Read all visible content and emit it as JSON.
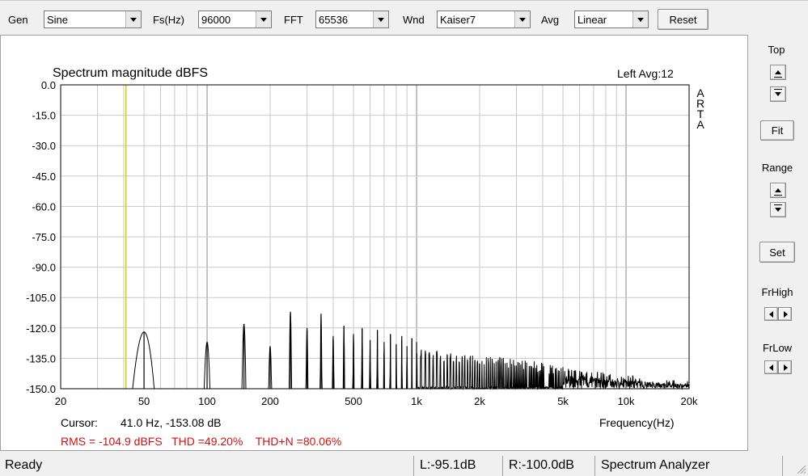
{
  "toolbar": {
    "gen_label": "Gen",
    "gen_value": "Sine",
    "fs_label": "Fs(Hz)",
    "fs_value": "96000",
    "fft_label": "FFT",
    "fft_value": "65536",
    "wnd_label": "Wnd",
    "wnd_value": "Kaiser7",
    "avg_label": "Avg",
    "avg_value": "Linear",
    "reset_label": "Reset"
  },
  "right_panel": {
    "top_label": "Top",
    "fit_label": "Fit",
    "range_label": "Range",
    "set_label": "Set",
    "frhigh_label": "FrHigh",
    "frlow_label": "FrLow"
  },
  "plot": {
    "vertical_watermark": "ARTA",
    "cursor_label": "Cursor:",
    "cursor_value": "41.0 Hz, -153.08 dB",
    "measurements": "RMS = -104.9 dBFS   THD =49.20%    THD+N =80.06%"
  },
  "chart_data": {
    "type": "line",
    "title": "Spectrum magnitude dBFS",
    "channel_info": "Left  Avg:12",
    "xlabel": "Frequency(Hz)",
    "ylabel": "",
    "x_scale": "log",
    "xlim": [
      20,
      20000
    ],
    "ylim": [
      -150,
      0
    ],
    "x_ticks": [
      20,
      50,
      100,
      200,
      500,
      1000,
      2000,
      5000,
      10000,
      20000
    ],
    "x_tick_labels": [
      "20",
      "50",
      "100",
      "200",
      "500",
      "1k",
      "2k",
      "5k",
      "10k",
      "20k"
    ],
    "y_ticks": [
      0,
      -15,
      -30,
      -45,
      -60,
      -75,
      -90,
      -105,
      -120,
      -135,
      -150
    ],
    "y_tick_labels": [
      "0.0",
      "-15.0",
      "-30.0",
      "-45.0",
      "-60.0",
      "-75.0",
      "-90.0",
      "-105.0",
      "-120.0",
      "-135.0",
      "-150.0"
    ],
    "grid": true,
    "cursor_frequency_hz": 41.0,
    "cursor_color": "#d4d400",
    "line_color": "#000000",
    "harmonic_peaks": {
      "frequencies_hz": [
        50,
        100,
        150,
        200,
        250,
        300,
        350,
        400,
        450,
        500,
        550,
        600,
        650,
        700,
        750,
        800,
        850,
        900,
        950,
        1000
      ],
      "levels_db": [
        -122,
        -127,
        -118,
        -129,
        -112,
        -120,
        -113,
        -124,
        -119,
        -123,
        -120,
        -126,
        -121,
        -127,
        -123,
        -128,
        -124,
        -129,
        -125,
        -127
      ]
    },
    "noise_floor": {
      "frequencies_hz": [
        1000,
        2000,
        3000,
        5000,
        10000,
        15000,
        20000
      ],
      "levels_db": [
        -130,
        -134,
        -135,
        -139,
        -143,
        -145,
        -146
      ]
    }
  },
  "status": {
    "ready": "Ready",
    "left_level": "L:-95.1dB",
    "right_level": "R:-100.0dB",
    "mode": "Spectrum Analyzer"
  }
}
